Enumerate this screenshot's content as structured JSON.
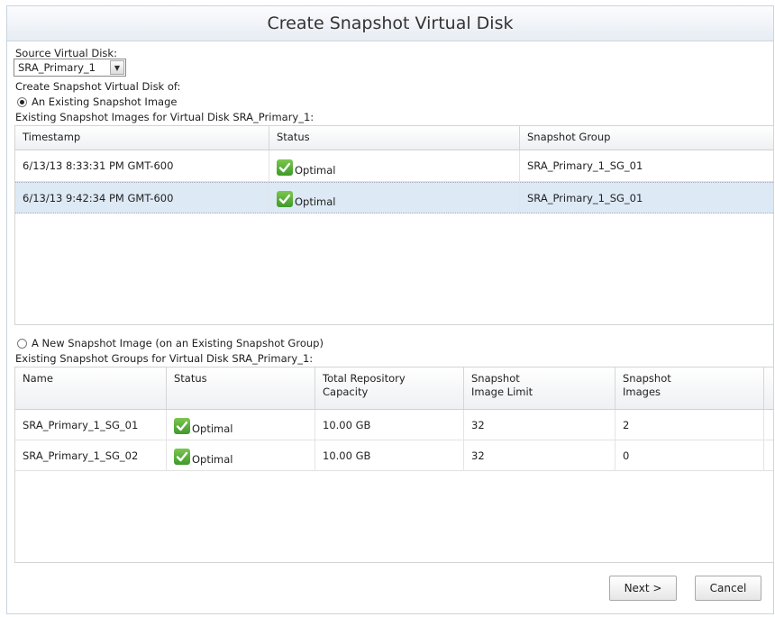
{
  "dialog": {
    "title": "Create Snapshot Virtual Disk"
  },
  "source": {
    "label": "Source Virtual Disk:",
    "selected": "SRA_Primary_1"
  },
  "create_of_label": "Create Snapshot Virtual Disk of:",
  "option_existing": {
    "label": "An Existing Snapshot Image",
    "checked": true
  },
  "images_table": {
    "caption": "Existing Snapshot Images for Virtual Disk SRA_Primary_1:",
    "headers": [
      "Timestamp",
      "Status",
      "Snapshot Group"
    ],
    "rows": [
      {
        "timestamp": "6/13/13 8:33:31 PM GMT-600",
        "status": "Optimal",
        "group": "SRA_Primary_1_SG_01",
        "selected": false
      },
      {
        "timestamp": "6/13/13 9:42:34 PM GMT-600",
        "status": "Optimal",
        "group": "SRA_Primary_1_SG_01",
        "selected": true
      }
    ]
  },
  "option_new": {
    "label": "A New Snapshot Image (on an Existing Snapshot Group)",
    "checked": false
  },
  "groups_table": {
    "caption": "Existing Snapshot Groups for Virtual Disk SRA_Primary_1:",
    "headers": {
      "name": "Name",
      "status": "Status",
      "capacity": [
        "Total Repository",
        "Capacity"
      ],
      "limit": [
        "Snapshot",
        "Image Limit"
      ],
      "images": [
        "Snapshot",
        "Images"
      ]
    },
    "rows": [
      {
        "name": "SRA_Primary_1_SG_01",
        "status": "Optimal",
        "capacity": "10.00 GB",
        "limit": "32",
        "images": "2"
      },
      {
        "name": "SRA_Primary_1_SG_02",
        "status": "Optimal",
        "capacity": "10.00 GB",
        "limit": "32",
        "images": "0"
      }
    ]
  },
  "buttons": {
    "next": "Next >",
    "cancel": "Cancel"
  },
  "colors": {
    "selected_row": "#dde9f5",
    "status_green": "#4caf2f"
  },
  "icons": {
    "status": "checkmark-icon",
    "dropdown": "chevron-down-icon"
  }
}
